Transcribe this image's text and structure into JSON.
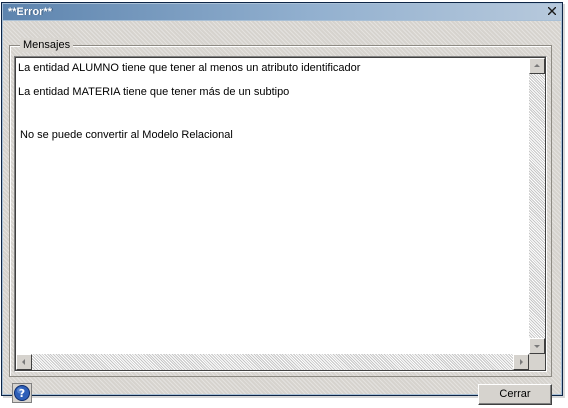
{
  "window": {
    "title": "**Error**",
    "close_icon": "close-icon"
  },
  "group": {
    "legend": "Mensajes"
  },
  "messages": [
    "La entidad ALUMNO tiene que tener al menos un atributo identificador",
    "La entidad MATERIA tiene que tener más de un subtipo",
    "No se puede convertir al Modelo Relacional"
  ],
  "buttons": {
    "help_icon": "help-icon",
    "close_label": "Cerrar"
  },
  "colors": {
    "titlebar_start": "#5d84ae",
    "titlebar_end": "#b7c9dc",
    "dialog_face": "#d6d3ce",
    "help_icon_blue": "#2e5fb8"
  }
}
